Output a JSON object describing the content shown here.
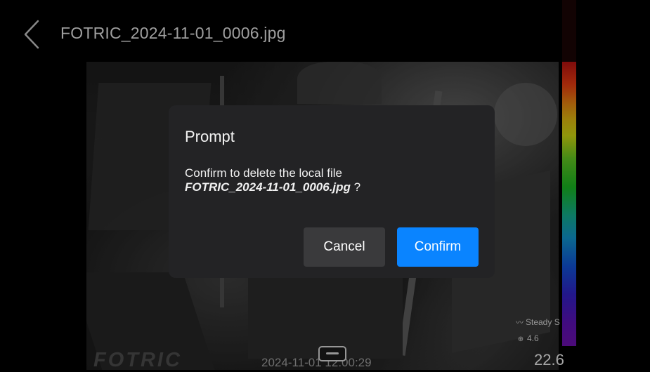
{
  "header": {
    "title": "FOTRIC_2024-11-01_0006.jpg"
  },
  "image_overlay": {
    "brand": "FOTRIC",
    "timestamp": "2024-11-01 12:00:29",
    "measure_mode": "Steady S",
    "emissivity": "4.6",
    "scale_min": "22.6"
  },
  "dialog": {
    "title": "Prompt",
    "message": "Confirm to delete the local file",
    "filename": "FOTRIC_2024-11-01_0006.jpg",
    "suffix": " ?",
    "cancel_label": "Cancel",
    "confirm_label": "Confirm"
  },
  "colors": {
    "confirm_button": "#0a84ff",
    "cancel_button": "#3a3a3c",
    "dialog_bg": "#232325"
  },
  "icons": {
    "back": "chevron-left-icon",
    "mode": "waveform-icon",
    "emissivity": "emissivity-icon",
    "notch": "expand-handle-icon"
  }
}
